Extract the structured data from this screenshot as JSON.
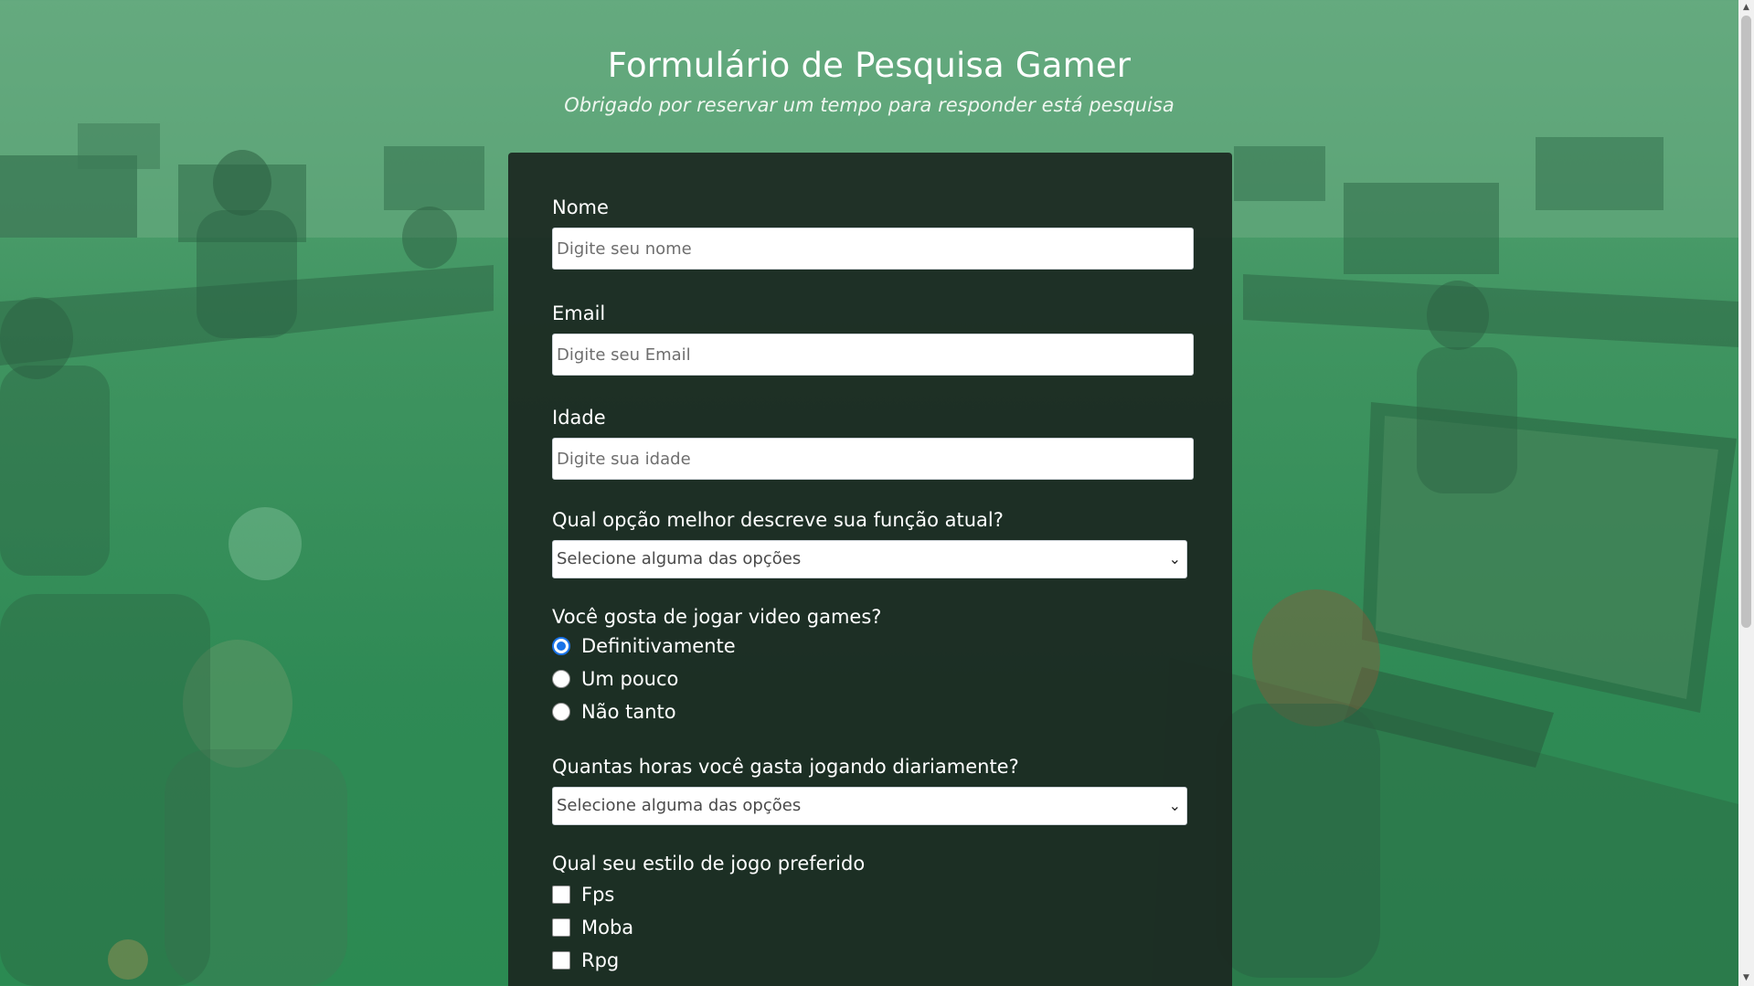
{
  "header": {
    "title": "Formulário de Pesquisa Gamer",
    "subtitle": "Obrigado por reservar um tempo para responder está pesquisa"
  },
  "form": {
    "name": {
      "label": "Nome",
      "placeholder": "Digite seu nome"
    },
    "email": {
      "label": "Email",
      "placeholder": "Digite seu Email"
    },
    "age": {
      "label": "Idade",
      "placeholder": "Digite sua idade"
    },
    "role": {
      "label": "Qual opção melhor descreve sua função atual?",
      "selected": "Selecione alguma das opções"
    },
    "likes_games": {
      "label": "Você gosta de jogar video games?",
      "options": [
        "Definitivamente",
        "Um pouco",
        "Não tanto"
      ],
      "selected_index": 0
    },
    "hours": {
      "label": "Quantas horas você gasta jogando diariamente?",
      "selected": "Selecione alguma das opções"
    },
    "style": {
      "label": "Qual seu estilo de jogo preferido",
      "options": [
        "Fps",
        "Moba",
        "Rpg"
      ]
    }
  },
  "icons": {
    "select_arrow": "chevron-down-icon",
    "scroll_up": "arrow-up-icon",
    "scroll_down": "arrow-down-icon"
  },
  "colors": {
    "card_background": "#1b2721",
    "radio_accent": "#1a73e8",
    "page_tint": "#3f9460"
  }
}
